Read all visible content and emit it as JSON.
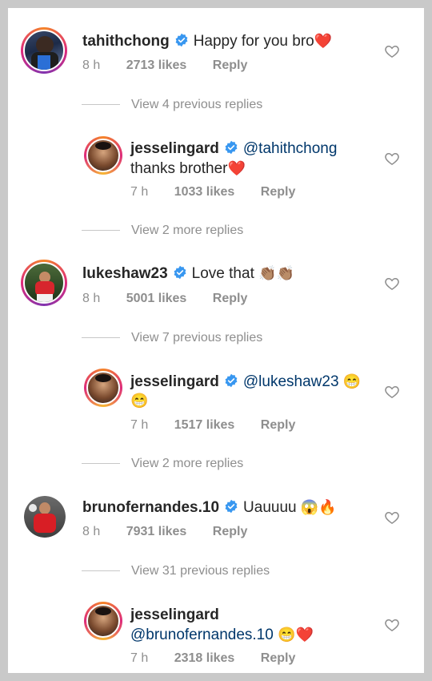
{
  "comments": [
    {
      "username": "tahithchong",
      "text": "Happy for you bro",
      "emoji": "❤️",
      "time": "8 h",
      "likes": "2713 likes",
      "reply": "Reply"
    },
    {
      "view_replies": "View 4 previous replies"
    },
    {
      "username": "jesselingard",
      "mention": "@tahithchong",
      "text": "thanks brother",
      "emoji": "❤️",
      "time": "7 h",
      "likes": "1033 likes",
      "reply": "Reply"
    },
    {
      "view_replies": "View 2 more replies"
    },
    {
      "username": "lukeshaw23",
      "text": "Love that",
      "emoji": "👏🏽👏🏽",
      "time": "8 h",
      "likes": "5001 likes",
      "reply": "Reply"
    },
    {
      "view_replies": "View 7 previous replies"
    },
    {
      "username": "jesselingard",
      "mention": "@lukeshaw23",
      "emoji": "😁",
      "emoji2": "😁",
      "time": "7 h",
      "likes": "1517 likes",
      "reply": "Reply"
    },
    {
      "view_replies": "View 2 more replies"
    },
    {
      "username": "brunofernandes.10",
      "text": "Uauuuu",
      "emoji": "😱🔥",
      "time": "8 h",
      "likes": "7931 likes",
      "reply": "Reply"
    },
    {
      "view_replies": "View 31 previous replies"
    },
    {
      "username": "jesselingard",
      "mention": "@brunofernandes.10",
      "emoji": "😁❤️",
      "time": "7 h",
      "likes": "2318 likes",
      "reply": "Reply"
    }
  ],
  "icons": {
    "verified": "verified-badge-icon",
    "like": "heart-outline-icon"
  },
  "colors": {
    "verified": "#3897f0",
    "mention": "#00376b",
    "meta": "#8e8e8e"
  }
}
